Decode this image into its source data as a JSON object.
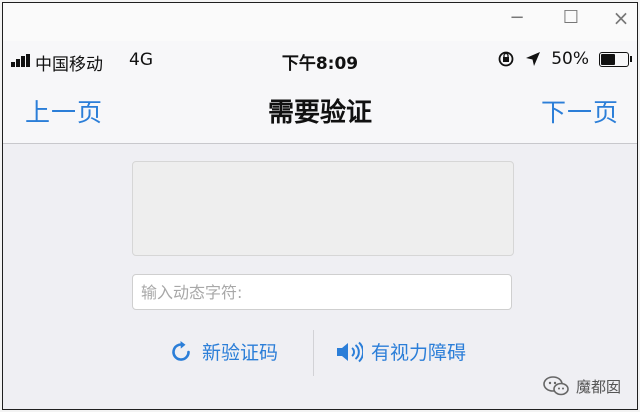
{
  "window": {
    "minimize_glyph": "−",
    "maximize_glyph": "☐",
    "close_glyph": "×"
  },
  "statusbar": {
    "carrier": "中国移动",
    "network": "4G",
    "time": "下午8:09",
    "battery_text": "50%",
    "battery_level": 0.5
  },
  "navbar": {
    "prev_label": "上一页",
    "title": "需要验证",
    "next_label": "下一页"
  },
  "verification": {
    "input_placeholder": "输入动态字符:",
    "refresh_label": "新验证码",
    "audio_label": "有视力障碍"
  },
  "watermark": {
    "text": "魔都囡"
  },
  "colors": {
    "accent": "#2b7ed8",
    "background": "#efeff3",
    "text": "#111111"
  },
  "icons": [
    "signal-icon",
    "location-icon",
    "battery-icon",
    "refresh-icon",
    "speaker-icon",
    "wechat-icon"
  ]
}
